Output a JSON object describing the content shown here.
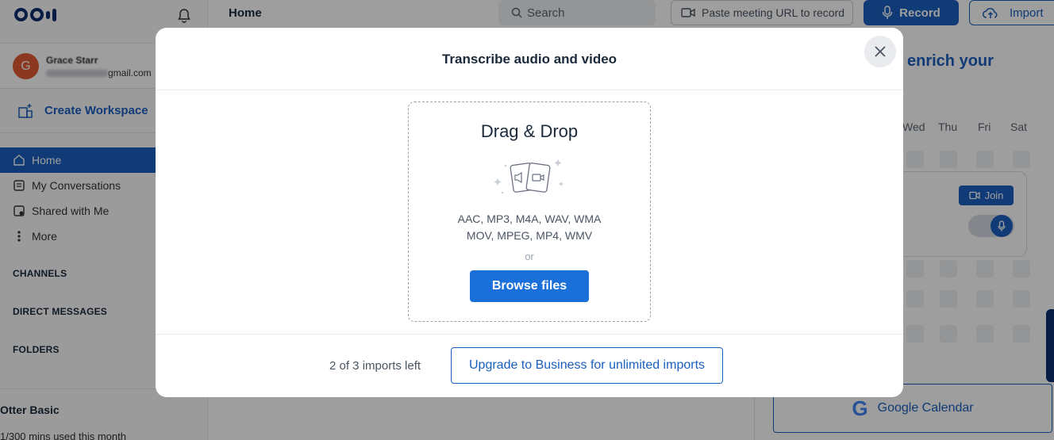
{
  "app": {
    "logo_text": "Otter",
    "bell_icon": "bell-icon"
  },
  "account": {
    "avatar_letter": "G",
    "name": "Grace Starr",
    "email_suffix": "gmail.com"
  },
  "sidebar": {
    "create_workspace": "Create Workspace",
    "items": [
      {
        "label": "Home",
        "icon": "home-icon",
        "active": true
      },
      {
        "label": "My Conversations",
        "icon": "conversations-icon"
      },
      {
        "label": "Shared with Me",
        "icon": "shared-icon"
      },
      {
        "label": "More",
        "icon": "more-icon"
      }
    ],
    "sections": [
      "CHANNELS",
      "DIRECT MESSAGES",
      "FOLDERS"
    ],
    "plan_title": "Otter Basic",
    "plan_usage": "1/300 mins used this month"
  },
  "topbar": {
    "page_title": "Home",
    "search_placeholder": "Search",
    "paste_placeholder": "Paste meeting URL to record",
    "record_label": "Record",
    "import_label": "Import"
  },
  "right_panel": {
    "heading_fragment": "enrich your",
    "days": [
      "Wed",
      "Thu",
      "Fri",
      "Sat"
    ],
    "join_label": "Join",
    "google_calendar_label": "Google Calendar"
  },
  "modal": {
    "title": "Transcribe audio and video",
    "close_icon": "close-icon",
    "drop_title": "Drag & Drop",
    "formats_line1": "AAC, MP3, M4A, WAV, WMA",
    "formats_line2": "MOV, MPEG, MP4, WMV",
    "or_text": "or",
    "browse_label": "Browse files",
    "imports_left": "2 of 3 imports left",
    "upgrade_label": "Upgrade to Business for unlimited imports"
  },
  "colors": {
    "brand_blue": "#1a5fbf",
    "browse_blue": "#1a6fd8",
    "navy": "#0b2e6f",
    "avatar": "#e25a33"
  }
}
